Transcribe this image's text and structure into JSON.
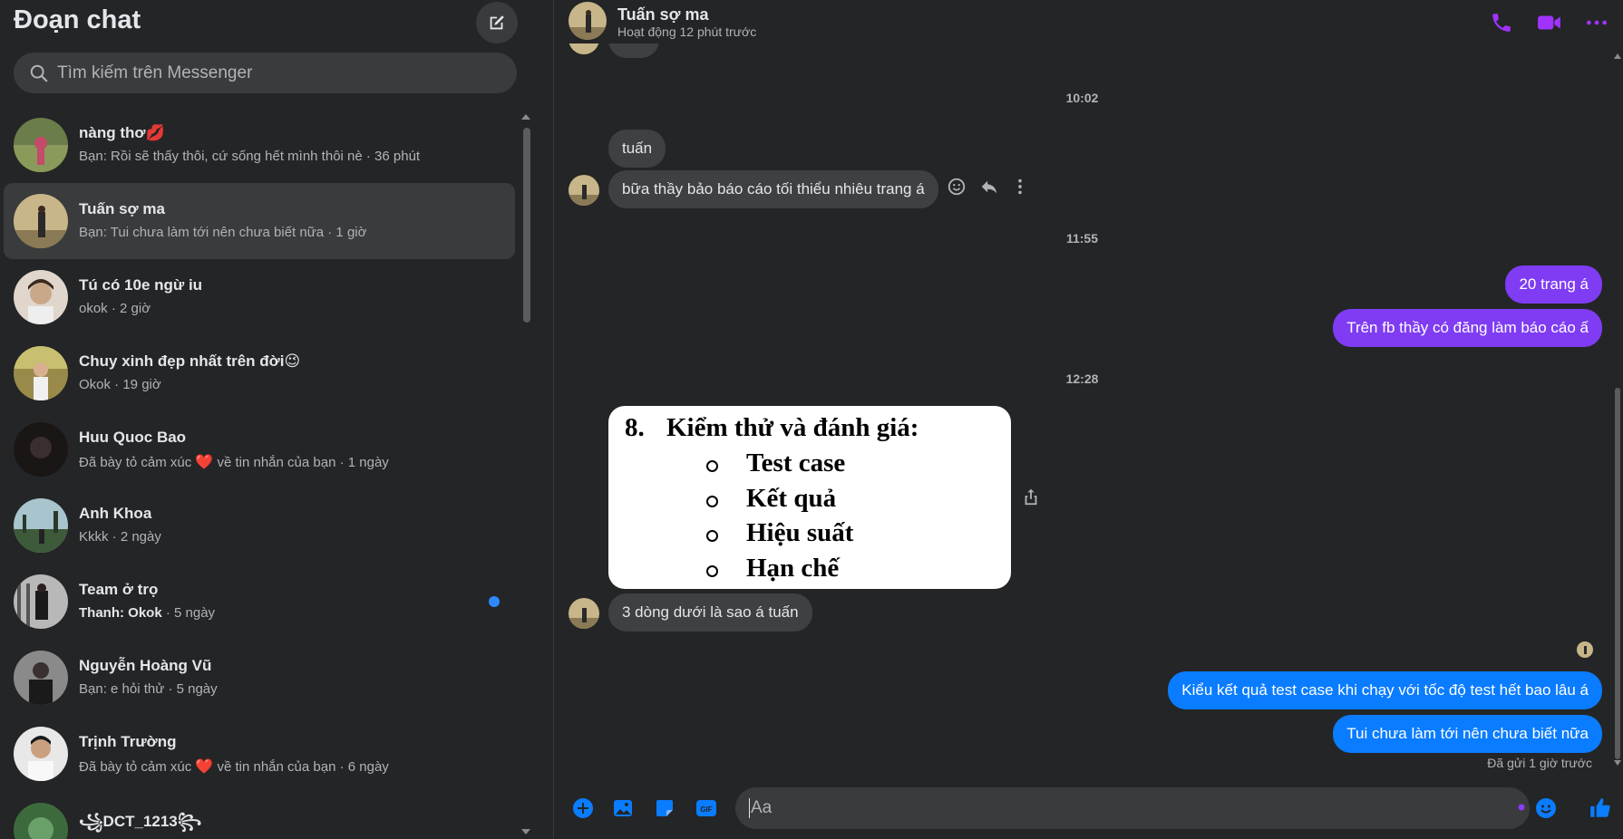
{
  "sidebar": {
    "title": "Đoạn chat",
    "search_placeholder": "Tìm kiếm trên Messenger",
    "conversations": [
      {
        "name": "nàng thơ💋",
        "preview": "Bạn: Rồi sẽ thấy thôi, cứ sống hết mình thôi nè · 36 phút",
        "avatar_color": "#6a7d4a"
      },
      {
        "name": "Tuấn sợ ma",
        "preview": "Bạn: Tui chưa làm tới nên chưa biết nữa · 1 giờ",
        "avatar_color": "#a08b5c"
      },
      {
        "name": "Tú có 10e ngừ iu",
        "preview": "okok · 2 giờ",
        "avatar_color": "#c9b8a6"
      },
      {
        "name": "Chuy xinh đẹp nhất trên đời😉",
        "preview": "Okok · 19 giờ",
        "avatar_color": "#7a6a3a"
      },
      {
        "name": "Huu Quoc Bao",
        "preview_before": "Đã bày tỏ cảm xúc ",
        "preview_heart": "❤️",
        "preview_after": " về tin nhắn của bạn · 1 ngày",
        "avatar_color": "#2a2222"
      },
      {
        "name": "Anh Khoa",
        "preview": "Kkkk · 2 ngày",
        "avatar_color": "#6f8a8f"
      },
      {
        "name": "Team ở trọ",
        "preview_bold": "Thanh: Okok",
        "preview_rest": " · 5 ngày",
        "unread": true,
        "avatar_color": "#9a9a9a"
      },
      {
        "name": "Nguyễn Hoàng Vũ",
        "preview": "Bạn: e hỏi thử · 5 ngày",
        "avatar_color": "#5a5a5a"
      },
      {
        "name": "Trịnh Trường",
        "preview_before": "Đã bày tỏ cảm xúc ",
        "preview_heart": "❤️",
        "preview_after": " về tin nhắn của bạn · 6 ngày",
        "avatar_color": "#d8d8d8"
      },
      {
        "name": "꧁DCT_1213꧂",
        "preview": "",
        "avatar_color": "#3d6a3d"
      }
    ]
  },
  "chat": {
    "contact_name": "Tuấn sợ ma",
    "contact_status": "Hoạt động 12 phút trước",
    "accent_color": "#a033ff",
    "timestamps": [
      "10:02",
      "11:55",
      "12:28"
    ],
    "messages": {
      "m1": "tuấn",
      "m2": "bữa thầy bảo báo cáo tối thiểu nhiêu trang á",
      "m3": "20 trang á",
      "m4": "Trên fb thầy có đăng làm báo cáo ấ",
      "m5": "3 dòng dưới là sao á tuấn",
      "m6": "Kiểu kết quả test case khi chạy với tốc độ test hết bao lâu á",
      "m7": "Tui chưa làm tới nên chưa biết nữa"
    },
    "image": {
      "heading_num": "8.",
      "heading_text": "Kiểm thử và đánh giá:",
      "items": [
        "Test case",
        "Kết quả",
        "Hiệu suất",
        "Hạn chế"
      ]
    },
    "sent_status": "Đã gửi 1 giờ trước",
    "composer_placeholder": "Aa"
  }
}
